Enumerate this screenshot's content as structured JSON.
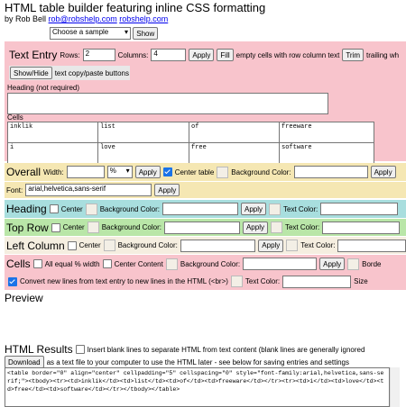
{
  "header": {
    "title": "HTML table builder featuring inline CSS formatting",
    "by": "by Rob Bell",
    "email": "rob@robshelp.com",
    "site": "robshelp.com",
    "sample_select": "Choose a sample",
    "show_button": "Show"
  },
  "text_entry": {
    "label": "Text Entry",
    "rows_label": "Rows:",
    "rows_value": "2",
    "columns_label": "Columns:",
    "columns_value": "4",
    "apply": "Apply",
    "fill": "Fill",
    "fill_text": "empty cells with row column text",
    "trim": "Trim",
    "trim_text": "trailing wh",
    "showhide": "Show/Hide",
    "copy_text": "text copy/paste buttons",
    "heading_label": "Heading (not required)",
    "cells_label": "Cells",
    "cells": [
      [
        "inklik",
        "list",
        "of",
        "freeware"
      ],
      [
        "i",
        "love",
        "free",
        "software"
      ]
    ]
  },
  "overall": {
    "label": "Overall",
    "width_label": "Width:",
    "unit": "%",
    "apply": "Apply",
    "center_table": "Center table",
    "bg_label": "Background Color:",
    "apply2": "Apply",
    "font_label": "Font:",
    "font_value": "arial,helvetica,sans-serif",
    "font_apply": "Apply"
  },
  "heading_row": {
    "label": "Heading",
    "center": "Center",
    "bg_label": "Background Color:",
    "apply": "Apply",
    "text_color": "Text Color:"
  },
  "top_row": {
    "label": "Top Row",
    "center": "Center",
    "bg_label": "Background Color:",
    "apply": "Apply",
    "text_color": "Text Color:"
  },
  "left_column": {
    "label": "Left Column",
    "center": "Center",
    "bg_label": "Background Color:",
    "apply": "Apply",
    "text_color": "Text Color:"
  },
  "cells_row": {
    "label": "Cells",
    "equal_width": "All equal % width",
    "center_content": "Center Content",
    "bg_label": "Background Color:",
    "apply": "Apply",
    "border": "Borde",
    "convert": "Convert new lines from text entry to new lines in the HTML (<br>)",
    "text_color": "Text Color:",
    "size": "Size"
  },
  "preview": {
    "label": "Preview"
  },
  "results": {
    "label": "HTML Results",
    "blank_lines": "Insert blank lines to separate HTML from text content (blank lines are generally ignored",
    "download": "Download",
    "download_text": "as a text file to your computer to use the HTML later - see below for saving entries and settings",
    "output": "<table border=\"0\" align=\"center\" cellpadding=\"5\" cellspacing=\"0\" style=\"font-family:arial,helvetica,sans-serif;\"><tbody><tr><td>inklik</td><td>list</td><td>of</td><td>freeware</td></tr><tr><td>i</td><td>love</td><td>free</td><td>software</td></tr></tbody></table>"
  }
}
